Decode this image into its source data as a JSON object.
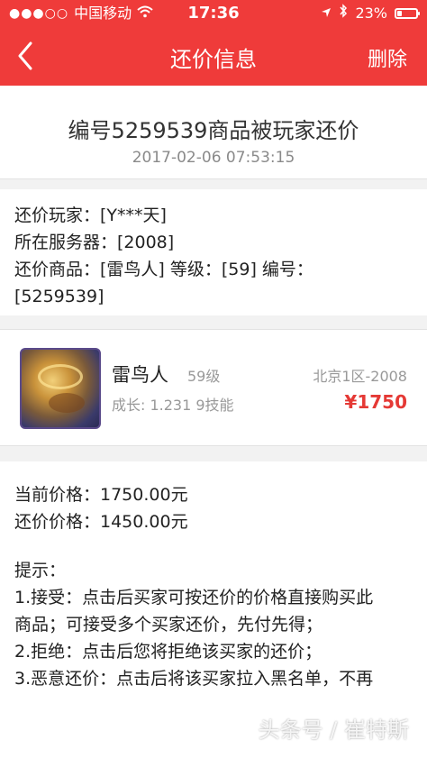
{
  "status_bar": {
    "signal": "●●●○○",
    "carrier": "中国移动",
    "time": "17:36",
    "battery_text": "23%",
    "battery_level": 0.23
  },
  "nav": {
    "title": "还价信息",
    "delete_label": "删除",
    "back_icon": "chevron-left-icon"
  },
  "header": {
    "title": "编号5259539商品被玩家还价",
    "datetime": "2017-02-06 07:53:15"
  },
  "info": {
    "player": "还价玩家：[Y***天]",
    "server": "所在服务器：[2008]",
    "item": "还价商品：[雷鸟人] 等级：[59] 编号：",
    "item_id": "[5259539]"
  },
  "product": {
    "name": "雷鸟人",
    "level": "59级",
    "growth_skills": "成长: 1.231  9技能",
    "server": "北京1区-2008",
    "price": "¥1750"
  },
  "prices": {
    "current": "当前价格：1750.00元",
    "offer": "还价价格：1450.00元"
  },
  "tips": {
    "heading": "提示：",
    "lines": [
      "1.接受：点击后买家可按还价的价格直接购买此",
      "商品；可接受多个买家还价，先付先得；",
      "2.拒绝：点击后您将拒绝该买家的还价；",
      "3.恶意还价：点击后将该买家拉入黑名单，不再"
    ]
  },
  "watermark": "头条号 / 崔特斯",
  "colors": {
    "brand_red": "#ef3b3a",
    "price_red": "#e53935"
  }
}
